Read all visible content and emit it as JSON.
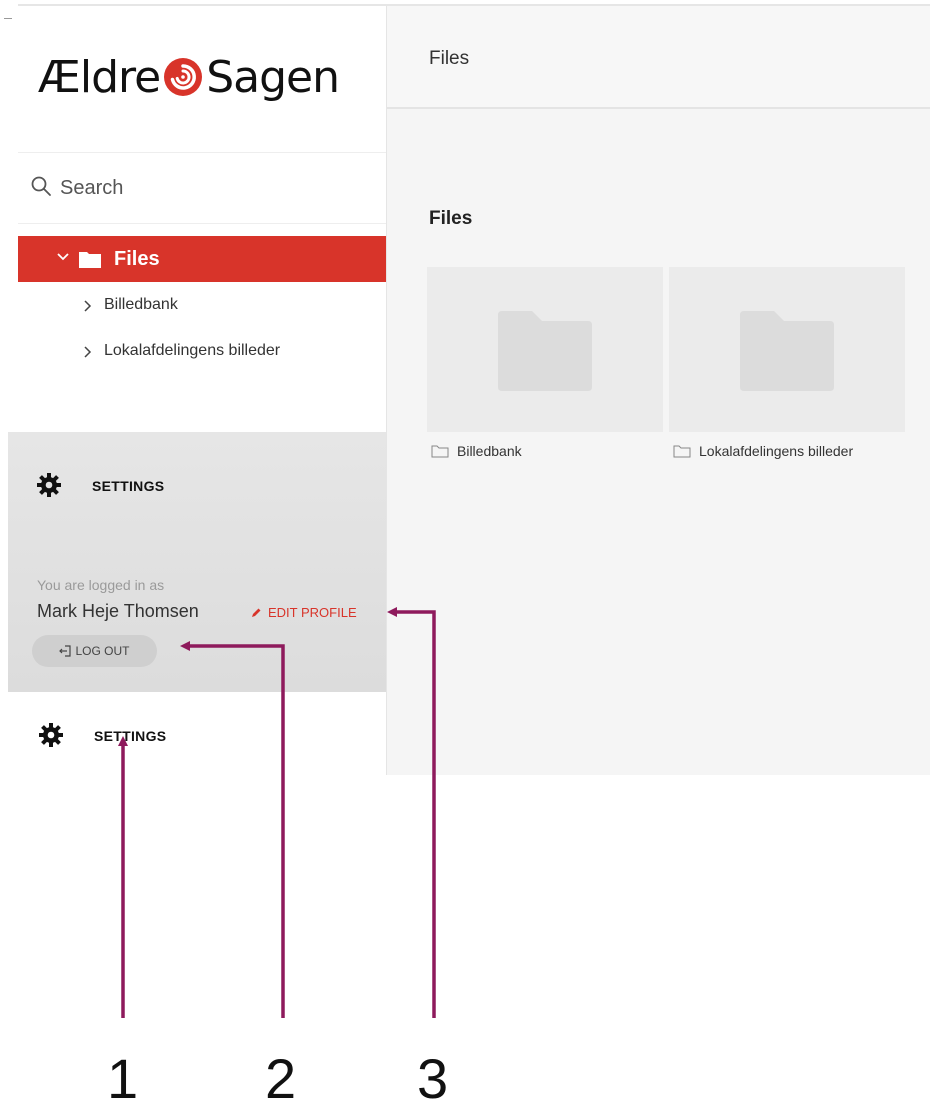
{
  "brand": {
    "logo_text_left": "Ældre",
    "logo_text_right": "Sagen",
    "accent_color": "#d8342a"
  },
  "sidebar": {
    "search": {
      "placeholder": "Search"
    },
    "tree": {
      "root": {
        "label": "Files",
        "icon": "folder-icon",
        "expanded": true,
        "active": true
      },
      "children": [
        {
          "label": "Billedbank",
          "icon": "chevron-right-icon"
        },
        {
          "label": "Lokalafdelingens billeder",
          "icon": "chevron-right-icon"
        }
      ]
    },
    "settings_panel": {
      "title": "SETTINGS",
      "logged_in_label": "You are logged in as",
      "user_name": "Mark Heje Thomsen",
      "edit_profile_label": "EDIT PROFILE",
      "logout_label": "LOG OUT"
    },
    "bottom_settings": {
      "label": "SETTINGS"
    }
  },
  "main": {
    "header_title": "Files",
    "section_title": "Files",
    "folders": [
      {
        "name": "Billedbank"
      },
      {
        "name": "Lokalafdelingens billeder"
      }
    ]
  },
  "annotations": {
    "color": "#8e1a5c",
    "labels": [
      "1",
      "2",
      "3"
    ]
  }
}
